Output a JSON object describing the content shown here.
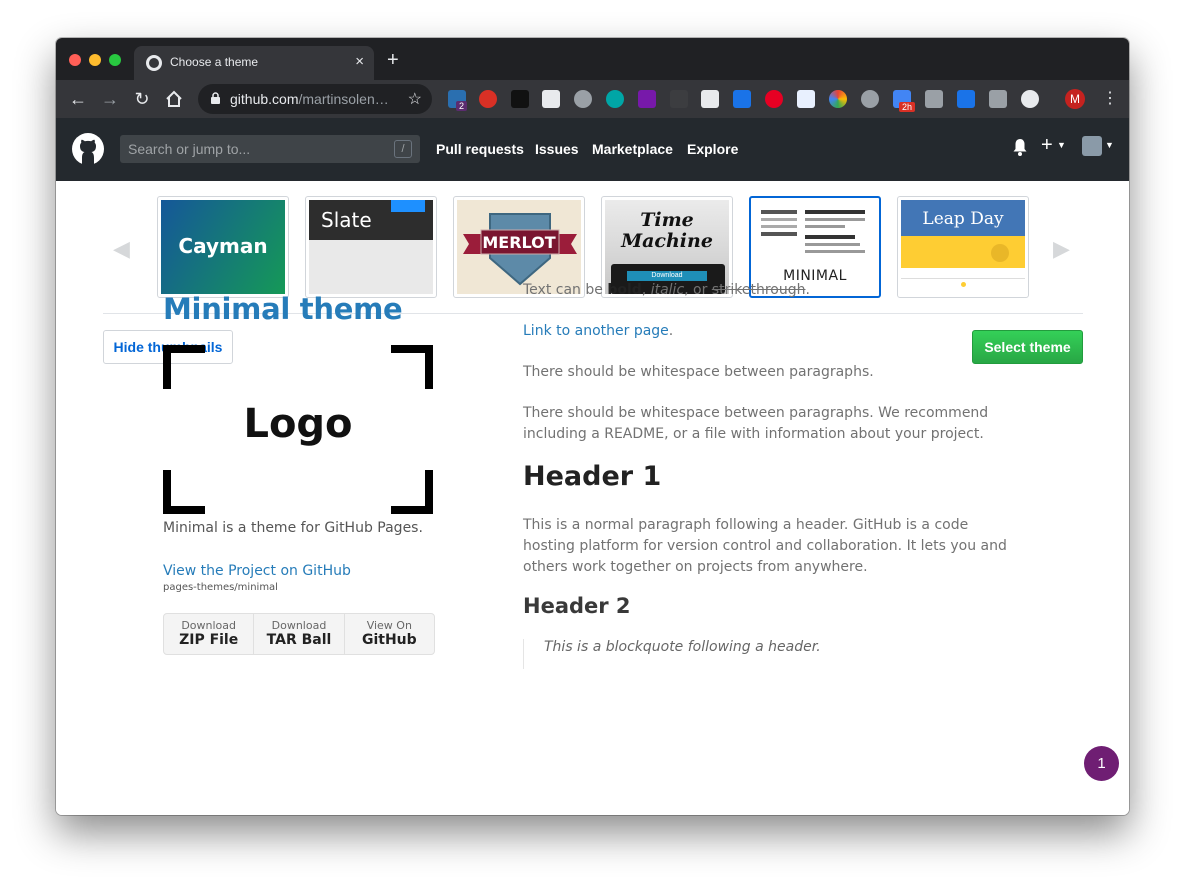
{
  "browser": {
    "tab_title": "Choose a theme",
    "tab_close": "×",
    "new_tab": "+",
    "url_host": "github.com",
    "url_path": "/martinsolen…",
    "profile_initial": "M",
    "ext_badges": {
      "ghostery": "2",
      "gmail": "2h"
    }
  },
  "github": {
    "search_placeholder": "Search or jump to...",
    "search_shortcut": "/",
    "nav": [
      "Pull requests",
      "Issues",
      "Marketplace",
      "Explore"
    ]
  },
  "themes": {
    "items": [
      {
        "name": "Cayman",
        "selected": false
      },
      {
        "name": "Slate",
        "selected": false
      },
      {
        "name": "MERLOT",
        "selected": false
      },
      {
        "name": "Time Machine",
        "sub": "Download",
        "selected": false
      },
      {
        "name": "MINIMAL",
        "selected": true
      },
      {
        "name": "Leap Day",
        "selected": false
      }
    ],
    "hide_button": "Hide thumbnails",
    "select_button": "Select theme"
  },
  "preview": {
    "title": "Minimal theme",
    "logo": "Logo",
    "description": "Minimal is a theme for GitHub Pages.",
    "project_link": "View the Project on GitHub",
    "project_path": "pages-themes/minimal",
    "downloads": [
      {
        "small": "Download",
        "big": "ZIP File"
      },
      {
        "small": "Download",
        "big": "TAR Ball"
      },
      {
        "small": "View On",
        "big": "GitHub"
      }
    ],
    "text_intro": "Text can be ",
    "text_bold": "bold",
    "text_comma1": ", ",
    "text_italic": "italic",
    "text_or": ", or ",
    "text_strike": "strikethrough",
    "text_period": ".",
    "link": "Link to another page",
    "para1": "There should be whitespace between paragraphs.",
    "para2": "There should be whitespace between paragraphs. We recommend including a README, or a file with information about your project.",
    "header1": "Header 1",
    "para3": "This is a normal paragraph following a header. GitHub is a code hosting platform for version control and collaboration. It lets you and others work together on projects from anywhere.",
    "header2": "Header 2",
    "blockquote": "This is a blockquote following a header."
  },
  "notification_count": "1"
}
